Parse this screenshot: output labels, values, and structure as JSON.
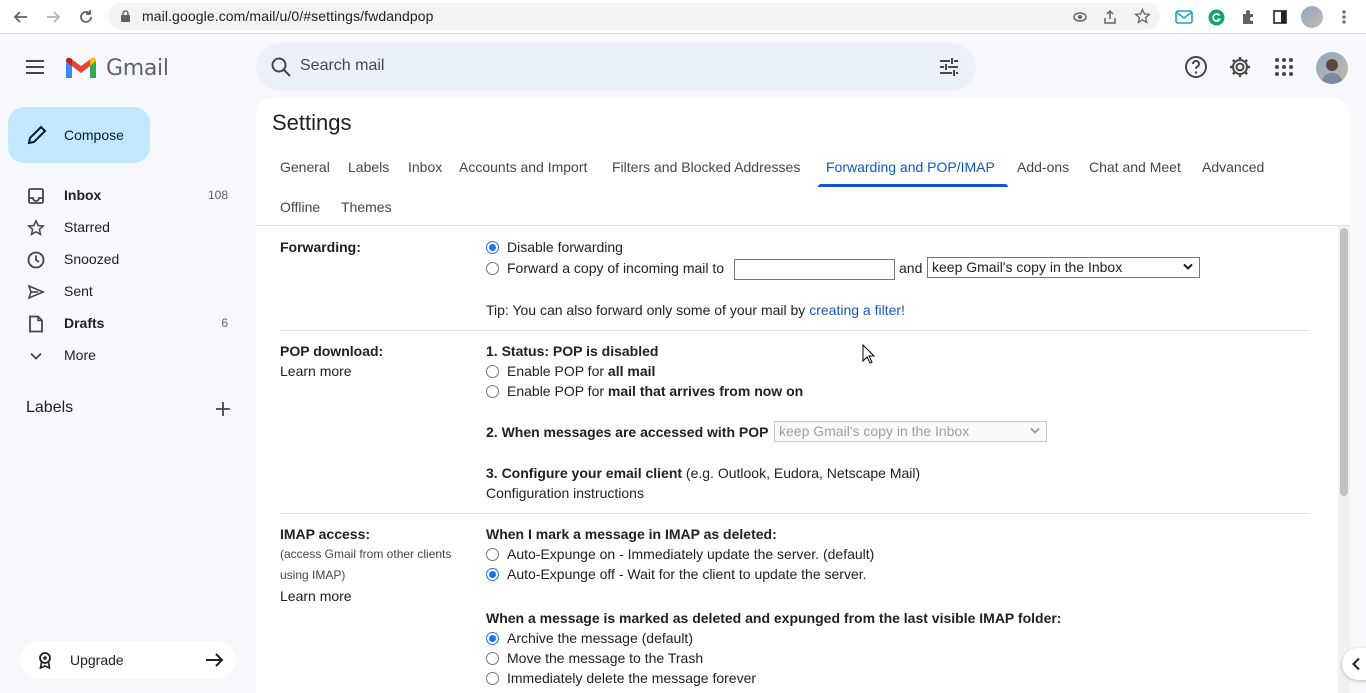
{
  "browser": {
    "url": "mail.google.com/mail/u/0/#settings/fwdandpop"
  },
  "app": {
    "name": "Gmail"
  },
  "search": {
    "placeholder": "Search mail"
  },
  "sidebar": {
    "compose_label": "Compose",
    "items": [
      {
        "label": "Inbox",
        "count": "108",
        "icon": "inbox-icon"
      },
      {
        "label": "Starred",
        "count": "",
        "icon": "star-icon"
      },
      {
        "label": "Snoozed",
        "count": "",
        "icon": "clock-icon"
      },
      {
        "label": "Sent",
        "count": "",
        "icon": "send-icon"
      },
      {
        "label": "Drafts",
        "count": "6",
        "icon": "draft-icon"
      },
      {
        "label": "More",
        "count": "",
        "icon": "chevron-down-icon"
      }
    ],
    "labels_heading": "Labels",
    "upgrade_label": "Upgrade"
  },
  "settings": {
    "title": "Settings",
    "tabs": [
      "General",
      "Labels",
      "Inbox",
      "Accounts and Import",
      "Filters and Blocked Addresses",
      "Forwarding and POP/IMAP",
      "Add-ons",
      "Chat and Meet",
      "Advanced",
      "Offline",
      "Themes"
    ],
    "active_tab": "Forwarding and POP/IMAP",
    "forwarding": {
      "label": "Forwarding:",
      "opt_disable": "Disable forwarding",
      "opt_forward": "Forward a copy of incoming mail to",
      "and": "and",
      "select_value": "keep Gmail's copy in the Inbox",
      "tip_prefix": "Tip: You can also forward only some of your mail by ",
      "tip_link": "creating a filter!"
    },
    "pop": {
      "label": "POP download:",
      "learn_more": "Learn more",
      "status": "1. Status: POP is disabled",
      "opt_all_prefix": "Enable POP for ",
      "opt_all_bold": "all mail",
      "opt_now_prefix": "Enable POP for ",
      "opt_now_bold": "mail that arrives from now on",
      "accessed_label": "2. When messages are accessed with POP",
      "accessed_select": "keep Gmail's copy in the Inbox",
      "configure_bold": "3. Configure your email client",
      "configure_rest": " (e.g. Outlook, Eudora, Netscape Mail)",
      "config_link": "Configuration instructions"
    },
    "imap": {
      "label": "IMAP access:",
      "sub1": "(access Gmail from other clients",
      "sub2": "using IMAP)",
      "learn_more": "Learn more",
      "deleted_heading": "When I mark a message in IMAP as deleted:",
      "opt_expunge_on": "Auto-Expunge on - Immediately update the server. (default)",
      "opt_expunge_off": "Auto-Expunge off - Wait for the client to update the server.",
      "expunged_heading": "When a message is marked as deleted and expunged from the last visible IMAP folder:",
      "opt_archive": "Archive the message (default)",
      "opt_trash": "Move the message to the Trash",
      "opt_delete": "Immediately delete the message forever"
    }
  }
}
